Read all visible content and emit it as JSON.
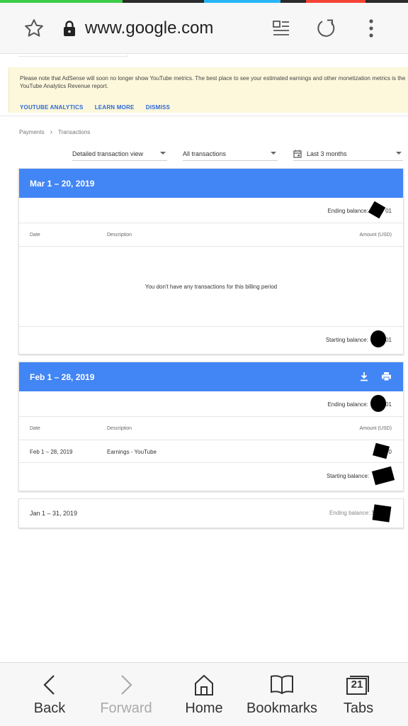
{
  "stripe_colors": [
    "#3ccc4a",
    "#2b2b2b",
    "#29b6f6",
    "#2b2b2b",
    "#f44336",
    "#2b2b2b"
  ],
  "browser": {
    "url": "www.google.com",
    "icons": [
      "star-icon",
      "lock-icon",
      "reader-icon",
      "reload-icon",
      "more-icon"
    ]
  },
  "notice": {
    "text": "Please note that AdSense will soon no longer show YouTube metrics. The best place to see your estimated earnings and other monetization metrics is the YouTube Analytics Revenue report.",
    "links": [
      "YOUTUBE ANALYTICS",
      "LEARN MORE",
      "DISMISS"
    ],
    "background": "#fdf7dc"
  },
  "breadcrumb": {
    "items": [
      "Payments",
      "Transactions"
    ]
  },
  "filters": {
    "view": "Detailed transaction view",
    "type": "All transactions",
    "range": "Last 3 months"
  },
  "columns": {
    "date": "Date",
    "description": "Description",
    "amount": "Amount (USD)"
  },
  "periods": [
    {
      "title": "Mar 1 – 20, 2019",
      "ending_balance": "Ending balance:",
      "ending_visible": "01",
      "empty_message": "You don't have any transactions for this billing period",
      "starting_balance": "Starting balance:",
      "starting_visible": "01"
    },
    {
      "title": "Feb 1 – 28, 2019",
      "ending_balance": "Ending balance:",
      "ending_visible": "01",
      "row": {
        "date": "Feb 1 – 28, 2019",
        "description": "Earnings - YouTube",
        "amount_visible": "0"
      },
      "starting_balance": "Starting balance:"
    },
    {
      "title": "Jan 1 – 31, 2019",
      "ending_balance": "Ending balance: $"
    }
  ],
  "accent_color": "#4285f4",
  "bottom_nav": {
    "back": "Back",
    "forward": "Forward",
    "home": "Home",
    "bookmarks": "Bookmarks",
    "tabs": "Tabs",
    "tabs_count": "21"
  }
}
